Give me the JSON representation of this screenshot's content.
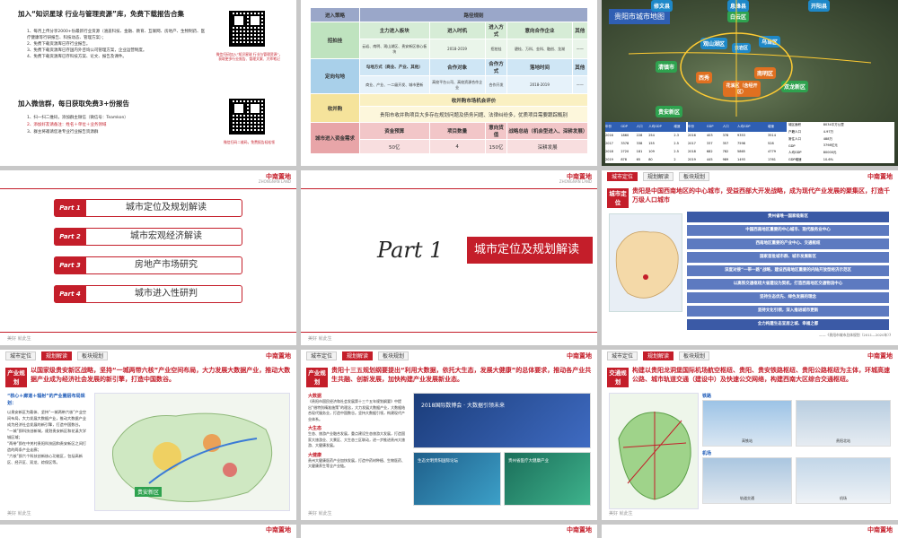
{
  "s1": {
    "title1": "加入“知识星球 行业与管理资源”库，免费下载报告合集",
    "items": [
      "1、每月上传分享2000+份最新行业资源（涵盖科技、金融、教育、互联网、房地产、生物制药、医疗健康等行研报告、科技动态、管理方案）；",
      "2、免费下载资源库已存行业报告。",
      "3、免费下载资源库已存国内外咨询公司管理方案，企业运营制度。",
      "4、免费下载资源库已存科技方案、论文、报告及课件。"
    ],
    "qr1_caption": "微信扫码加入“知识星球 行业与管理资源”，获取更多行业报告、管理文案、大师笔记",
    "title2": "加入微信群，每日获取免费3+份报告",
    "items2": [
      "1、扫一扫二维码，添加群主微信（微信号：Teamkon）",
      "2、添加好友请备注：姓名＋单位＋业务领域",
      "3、群主将邀请您进专业行业报告资源群"
    ],
    "qr2_caption": "微信扫码二维码，免费报告轻松领"
  },
  "s2": {
    "r1_h": "进入策略",
    "r1_c": "路径规则",
    "r2_h": "招拍挂",
    "r2_cols": [
      "主力进入板块",
      "进入时机",
      "进入方式",
      "意向合作企业",
      "其他"
    ],
    "r2_vals": [
      "云岩、南明、观山湖区、贵安新区核心板块",
      "2018-2019",
      "招拍挂",
      "碧桂、万科、金科、融创、龙湖",
      "——"
    ],
    "r3_h": "定向勾地",
    "r3_cols": [
      "勾地方式（商业、产业、其他）",
      "合作对象",
      "合作方式",
      "落地时间",
      "其他"
    ],
    "r3_vals": [
      "商业、产业、一二级开发、城市更新",
      "高校平台公司、高校资源合作企业",
      "合作开发",
      "2018-2019",
      "——"
    ],
    "r4_h": "收并购",
    "r4_title": "收并购市场机会评价",
    "r4_text": "贵阳市收并购项目大多存在规划问题及债务问题、法律纠纷多，优质项目需要跟踪甄别",
    "r5_h": "城市进入资金需求",
    "r5_cols": [
      "资金预算",
      "项目数量",
      "意向货值",
      "战略总结（机会型进入、深耕发展）"
    ],
    "r5_vals": [
      "50亿",
      "4",
      "150亿",
      "深耕发展"
    ]
  },
  "s3": {
    "title": "贵阳市城市地图",
    "districts": [
      "白云区",
      "观山湖区",
      "乌当区",
      "清镇市",
      "云岩区",
      "西秀",
      "南明区",
      "花溪区（含经开区）",
      "双龙新区",
      "贵安新区",
      "开阳县",
      "修文县",
      "息烽县"
    ],
    "t1_headers": [
      "年份",
      "GDP",
      "人口",
      "人均GDP",
      "增速"
    ],
    "t1_rows": [
      [
        "2016",
        "1860",
        "228",
        "254",
        "2235",
        "2.3"
      ],
      [
        "2017",
        "3378",
        "338",
        "155",
        "2833",
        "2.5"
      ],
      [
        "2018",
        "2720",
        "181",
        "109",
        "1642",
        "2.5"
      ],
      [
        "2019",
        "878",
        "65",
        "80",
        "1121",
        "2"
      ],
      [
        "2020",
        "900",
        "70",
        "90",
        "1200",
        "2"
      ]
    ],
    "t2_rows": [
      [
        "2016",
        "403",
        "378",
        "9353",
        "3514"
      ],
      [
        "2017",
        "337",
        "357",
        "7598",
        "528"
      ],
      [
        "2018",
        "682",
        "782",
        "5865",
        "4779"
      ],
      [
        "2019",
        "445",
        "989",
        "1493",
        "1761"
      ],
      [
        "2020",
        "2975",
        "2098",
        "5290",
        "1773"
      ]
    ],
    "t3_rows": [
      [
        "城区面积",
        "8034平方公里"
      ],
      [
        "户籍人口",
        "4.97万"
      ],
      [
        "常住人口",
        "488万"
      ],
      [
        "GDP",
        "3798亿元"
      ],
      [
        "人均GDP",
        "80000元"
      ],
      [
        "GDP增速",
        "10.6%"
      ],
      [
        "第一产业增加值",
        "152.3亿元"
      ],
      [
        "第二产业增加值",
        "1452.1亿元"
      ],
      [
        "第三产业增加值",
        "2194.2亿元"
      ],
      [
        "城镇居民可支配收入",
        "3205元"
      ]
    ]
  },
  "common": {
    "logo": "中南置地",
    "logo_sub": "ZHONGNAN LAND",
    "footer": "美好 就此生",
    "nav1": "城市定位",
    "nav2": "规划解读",
    "nav3": "板块规划"
  },
  "s4": {
    "parts": [
      {
        "tag": "Part 1",
        "label": "城市定位及规划解读"
      },
      {
        "tag": "Part 2",
        "label": "城市宏观经济解读"
      },
      {
        "tag": "Part 3",
        "label": "房地产市场研究"
      },
      {
        "tag": "Part 4",
        "label": "城市进入性研判"
      }
    ]
  },
  "s5": {
    "part": "Part 1",
    "title": "城市定位及规划解读"
  },
  "s6": {
    "sec": "城市定位",
    "title": "贵阳是中国西南地区的中心城市，受益西部大开发战略，成为现代产业发展的聚集区，打造千万级人口城市",
    "strategy": [
      "贵州省唯一国家级新区",
      "中国西南地区重要的中心城市、现代服务业中心",
      "西南地区重要的产业中心、交通枢纽",
      "国家首批城市群、城市发展新区",
      "深度对接“一带一路”战略，建设西南地区重要的内陆开放型经济示范区",
      "以高铁交通枢纽大省建设为契机，打造西南地区交通物流中心",
      "坚持生态优先、绿色发展的理念",
      "坚持文化引领，深入推进城市更新",
      "坚持科技创新、产业升级战略，推动高质量发展",
      "全力构建生态宜居之城、幸福之都"
    ],
    "source": "——《贵阳市城市总体规划（2011—2020年）》"
  },
  "s7": {
    "sec": "产业规划",
    "title": "以国家级贵安新区战略，坚持“一城两带六核”产业空间布局，大力发展大数据产业，推动大数据产业成为经济社会发展的新引擎，打造中国数谷。",
    "bullet_title": "“核心＋廊道＋辐射”的产业圈层布局规划：",
    "text": [
      "以贵安新区为载体、坚持“一城两带六核”产业空间布局，大力发展大数据产业，推动大数据产业成为经济社会发展的新引擎，打造中国数谷。",
      "“一城”即科技创新城，规划贵安新区和花溪大学城区域；",
      "“两带”即在中关村贵阳科技园和贵安新区之间打造的两条产业走廊；",
      "“六核”即六个科技创新核心功能区，包括高新区、经开区、双龙、综保区等。"
    ],
    "map_label": "贵安新区"
  },
  "s8": {
    "sec": "产业规划",
    "title": "贵阳十三五规划纲要提出“利用大数据，依托大生态，发展大健康”的总体要求，推动各产业共生共融、创新发展，加快构建产业发展新业态。",
    "items": [
      {
        "h": "大数据",
        "t": "《贵阳市国民经济和社会发展第十三个五年规划纲要》中提出“借特别精准施策”的理念，大力发展大数据产业，大数据结合现代服务业，打造中国数谷。坚持大数据引领，构建现代产业体系。"
      },
      {
        "h": "大生态",
        "t": "生态、旅游产业融合发展，重点建设生态旅游大发展，打造国家大旅游业、大景区、大生态三区联动，进一步推进贵州大旅游、大健康发展。"
      },
      {
        "h": "大健康",
        "t": "贵州大健康医药产业加快发展，打造中药材种植、生物医药、大健康养生等全产业链。"
      }
    ],
    "banner1": "2018国际数博会 · 大数据引领未来",
    "banner2": "生态文明贵阳国际论坛",
    "banner3": "贵州省医疗大健康产业"
  },
  "s9": {
    "sec": "交通规划",
    "title": "构建以贵阳龙洞堡国际机场航空枢纽、贵阳、贵安铁路枢纽、贵阳公路枢纽为主体，环城高速公路、城市轨道交通（建设中）及快速公交网络，构建西南大区综合交通枢纽。",
    "photo1": "高铁站",
    "photo2": "贵阳北站",
    "photo3": "轨道交通",
    "photo4": "机场",
    "h1": "铁路",
    "h2": "机场"
  }
}
